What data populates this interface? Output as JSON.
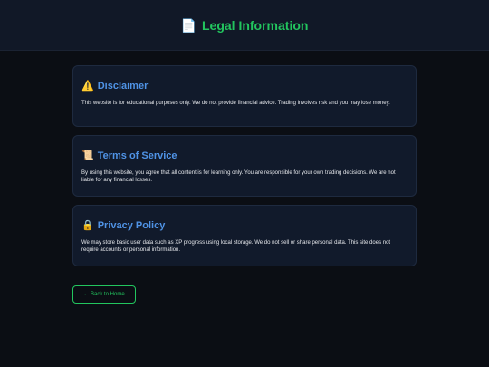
{
  "header": {
    "icon": "document-icon",
    "icon_glyph": "📄",
    "title": "Legal Information"
  },
  "sections": [
    {
      "icon": "warning-icon",
      "icon_glyph": "⚠️",
      "title": "Disclaimer",
      "text": "This website is for educational purposes only. We do not provide financial advice. Trading involves risk and you may lose money."
    },
    {
      "icon": "scroll-icon",
      "icon_glyph": "📜",
      "title": "Terms of Service",
      "text": "By using this website, you agree that all content is for learning only. You are responsible for your own trading decisions. We are not liable for any financial losses."
    },
    {
      "icon": "lock-icon",
      "icon_glyph": "🔒",
      "title": "Privacy Policy",
      "text": "We may store basic user data such as XP progress using local storage. We do not sell or share personal data. This site does not require accounts or personal information."
    }
  ],
  "back_button": {
    "label": "← Back to Home"
  },
  "colors": {
    "accent_green": "#22c55e",
    "heading_blue": "#4f93e6",
    "background": "#0b0e14",
    "card_background": "#111a2b"
  }
}
